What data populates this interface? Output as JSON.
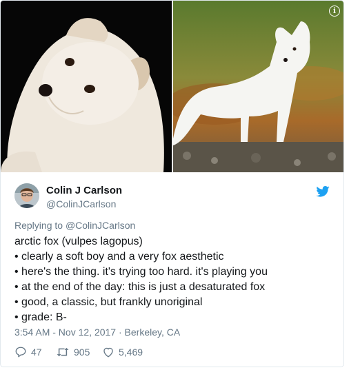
{
  "media": {
    "icon": "info-icon",
    "left_alt_icon": "arctic-fox-photo",
    "right_alt_icon": "arctic-fox-standing-photo"
  },
  "tweet": {
    "author_name": "Colin J Carlson",
    "author_handle": "@ColinJCarlson",
    "reply_prefix": "Replying to",
    "reply_to": "@ColinJCarlson",
    "lines": [
      "arctic fox (vulpes lagopus)",
      "• clearly a soft boy and a very fox aesthetic",
      "• here's the thing. it's trying too hard. it's playing you",
      "• at the end of the day: this is just a desaturated fox",
      "• good, a classic, but frankly unoriginal",
      "• grade: B-"
    ],
    "meta": "3:54 AM - Nov 12, 2017 · Berkeley, CA",
    "replies": "47",
    "retweets": "905",
    "likes": "5,469",
    "brand_color": "#1da1f2"
  }
}
